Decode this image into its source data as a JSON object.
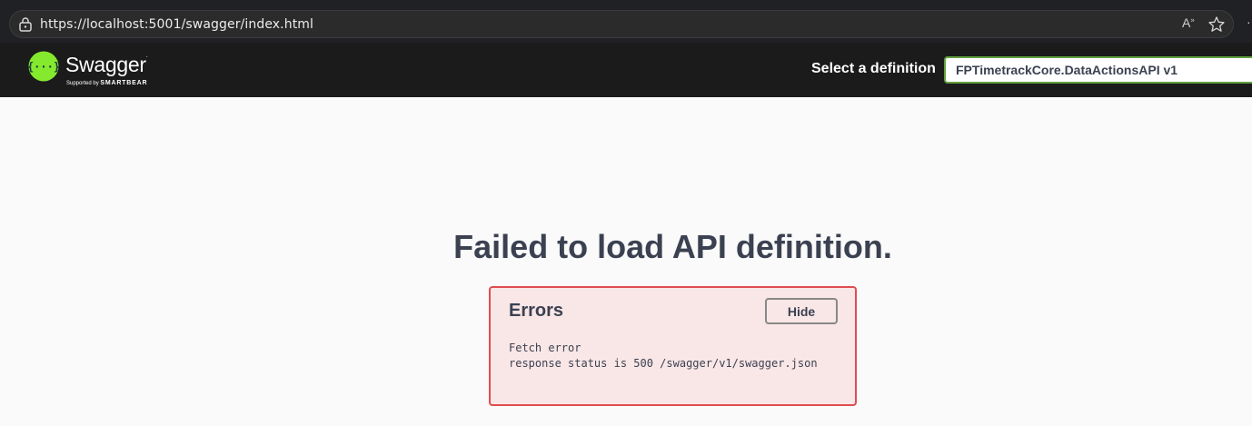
{
  "browser": {
    "url": "https://localhost:5001/swagger/index.html",
    "icons": [
      "lock-icon",
      "read-aloud-icon",
      "favorite-star-icon"
    ]
  },
  "topbar": {
    "logo_text": "Swagger",
    "logo_subtext_prefix": "Supported by",
    "logo_subtext_brand": "SMARTBEAR",
    "select_label": "Select a definition",
    "selected_definition": "FPTimetrackCore.DataActionsAPI v1",
    "accent": "#62a03f"
  },
  "main": {
    "title": "Failed to load API definition.",
    "errors": {
      "heading": "Errors",
      "hide_label": "Hide",
      "error_title": "Fetch error",
      "error_message": "response status is 500 /swagger/v1/swagger.json",
      "border_color": "#e04c51",
      "background": "#f9e6e6"
    }
  }
}
